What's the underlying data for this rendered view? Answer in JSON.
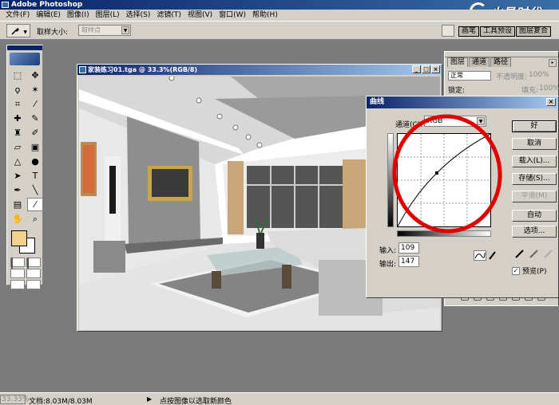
{
  "app": {
    "title": "Adobe Photoshop",
    "brand": "火星时代"
  },
  "menu": [
    "文件(F)",
    "编辑(E)",
    "图像(I)",
    "图层(L)",
    "选择(S)",
    "滤镜(T)",
    "视图(V)",
    "窗口(W)",
    "帮助(H)"
  ],
  "options": {
    "sample_label": "取样大小:",
    "sample_value": "取样点"
  },
  "palette_well": [
    "画笔",
    "工具预设",
    "图层复合"
  ],
  "document": {
    "title": "家装练习01.tga @ 33.3%(RGB/8)"
  },
  "curves": {
    "title": "曲线",
    "channel_label": "通道(C):",
    "channel_value": "RGB",
    "input_label": "输入:",
    "input_value": "109",
    "output_label": "输出:",
    "output_value": "147",
    "buttons": [
      "好",
      "取消",
      "载入(L)...",
      "存储(S)...",
      "平滑(M)",
      "自动",
      "选项..."
    ],
    "preview_label": "预览(P)"
  },
  "layers": {
    "tabs": [
      "图层",
      "通道",
      "路径"
    ],
    "blend_mode": "正常",
    "opacity_label": "不透明度:",
    "opacity_value": "100%",
    "lock_label": "锁定:",
    "fill_label": "填充:",
    "fill_value": "100%"
  },
  "status": {
    "zoom": "33.33%",
    "doc_size": "文档:8.03M/8.03M",
    "message": "点按图像以选取新颜色"
  },
  "colors": {
    "foreground": "#f4d28a",
    "background": "#ffffff",
    "accent": "#0a246a"
  }
}
